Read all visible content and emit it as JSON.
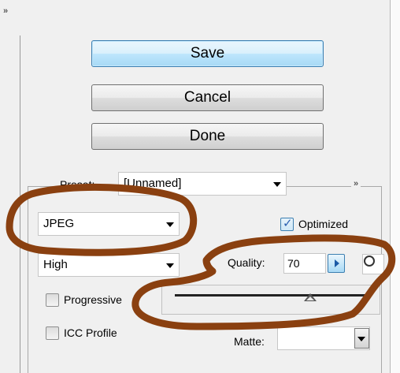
{
  "left_panel": {
    "more_glyph": "»"
  },
  "buttons": {
    "save": "Save",
    "cancel": "Cancel",
    "done": "Done"
  },
  "settings": {
    "more_glyph": "»",
    "preset": {
      "label": "Preset:",
      "value": "[Unnamed]"
    },
    "format": {
      "value": "JPEG"
    },
    "optimized": {
      "label": "Optimized",
      "checked": true
    },
    "compression": {
      "value": "High"
    },
    "quality": {
      "label": "Quality:",
      "value": "70",
      "slider_fraction": 0.7
    },
    "progressive": {
      "label": "Progressive",
      "checked": false
    },
    "icc_profile": {
      "label": "ICC Profile",
      "checked": false
    },
    "matte": {
      "label": "Matte:",
      "value": ""
    }
  },
  "annotation_color": "#8a4010",
  "accent_color": "#3c7fb1"
}
